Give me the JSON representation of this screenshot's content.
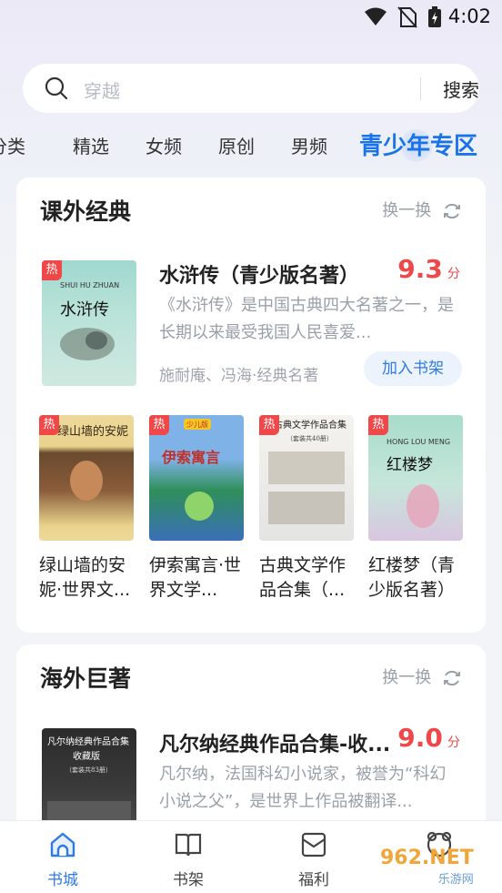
{
  "status": {
    "time": "4:02"
  },
  "search": {
    "placeholder": "穿越",
    "button": "搜索"
  },
  "tabs": [
    {
      "label": "分类"
    },
    {
      "label": "精选"
    },
    {
      "label": "女频"
    },
    {
      "label": "原创"
    },
    {
      "label": "男频"
    },
    {
      "label": "青少年专区",
      "active": true
    }
  ],
  "section1": {
    "title": "课外经典",
    "refresh": "换一换",
    "featured": {
      "badge": "热",
      "title": "水浒传（青少版名著）",
      "score": "9.3",
      "score_unit": "分",
      "desc": "《水浒传》是中国古典四大名著之一，是长期以来最受我国人民喜爱...",
      "author": "施耐庵、冯海·经典名著",
      "action": "加入书架",
      "cover_text": [
        "SHUI HU ZHUAN",
        "水浒传"
      ]
    },
    "books": [
      {
        "badge": "热",
        "title": "绿山墙的安妮·世界文...",
        "cover_text": "绿山墙的安妮"
      },
      {
        "badge": "热",
        "title": "伊索寓言·世界文学...",
        "cover_text": "伊索寓言",
        "cover_tag": "少儿版"
      },
      {
        "badge": "热",
        "title": "古典文学作品合集（...",
        "cover_text": "古典文学作品合集",
        "cover_sub": "（套装共40册）"
      },
      {
        "badge": "热",
        "title": "红楼梦（青少版名著）",
        "cover_text": "红楼梦",
        "cover_pinyin": "HONG LOU MENG"
      }
    ]
  },
  "section2": {
    "title": "海外巨著",
    "refresh": "换一换",
    "featured": {
      "title": "凡尔纳经典作品合集-收...",
      "score": "9.0",
      "score_unit": "分",
      "desc": "凡尔纳，法国科幻小说家，被誉为“科幻小说之父”，是世界上作品被翻译...",
      "cover_text": [
        "凡尔纳经典作品合集",
        "收藏版",
        "（套装共83册）"
      ]
    }
  },
  "nav": [
    {
      "label": "书城",
      "icon": "home-icon",
      "active": true
    },
    {
      "label": "书架",
      "icon": "book-icon"
    },
    {
      "label": "福利",
      "icon": "gift-icon"
    },
    {
      "label": "",
      "icon": "profile-icon"
    }
  ],
  "watermark": {
    "main": "962.NET",
    "sub": "乐游网"
  },
  "colors": {
    "accent": "#2d7ae4",
    "score": "#f04848",
    "badge": "#f04848"
  }
}
